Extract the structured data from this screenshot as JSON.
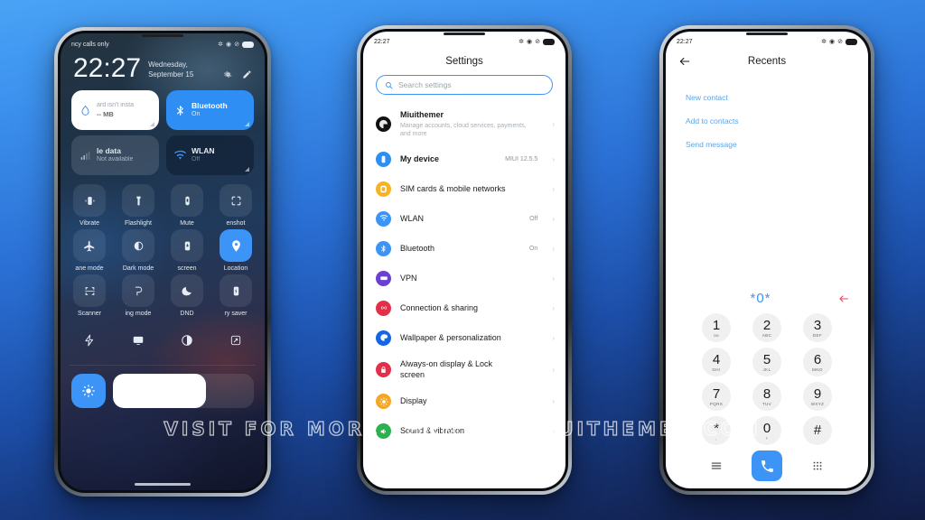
{
  "background": {
    "top_color": "#4aa3f5",
    "bottom_color": "#121c44"
  },
  "watermark": {
    "text": "VISIT FOR MORE THEMES - MIUITHEMER.COM"
  },
  "accent": {
    "blue": "#3c94f6",
    "link_blue": "#5ba5e8",
    "red": "#e8445f"
  },
  "phone1": {
    "name": "control-center",
    "status_bar": {
      "carrier": "ncy calls only",
      "icons": [
        "bluetooth-icon",
        "alarm-icon",
        "dnd-icon"
      ],
      "battery": "battery-icon"
    },
    "clock": {
      "time": "22:27",
      "date_line1": "Wednesday,",
      "date_line2": "September 15"
    },
    "header_actions": [
      "settings-gear-icon",
      "edit-pencil-icon"
    ],
    "big_tiles": [
      {
        "title": "ard isn't insta",
        "sub": "-- MB",
        "icon": "storage-drop-icon",
        "style": "white"
      },
      {
        "title": "Bluetooth",
        "sub": "On",
        "icon": "bluetooth-icon",
        "style": "blue"
      },
      {
        "title": "le data",
        "sub": "Not available",
        "icon": "signal-bars-icon",
        "style": "dim"
      },
      {
        "title": "WLAN",
        "sub": "Off",
        "icon": "wifi-icon",
        "style": "dark"
      }
    ],
    "toggles": [
      {
        "label": "Vibrate",
        "icon": "vibrate-icon",
        "on": false
      },
      {
        "label": "Flashlight",
        "icon": "flashlight-icon",
        "on": false
      },
      {
        "label": "Mute",
        "icon": "mute-icon",
        "on": false
      },
      {
        "label": "enshot",
        "icon": "screenshot-icon",
        "on": false
      },
      {
        "label": "ane mode",
        "icon": "airplane-icon",
        "on": false
      },
      {
        "label": "Dark mode",
        "icon": "dark-mode-icon",
        "on": false
      },
      {
        "label": "screen",
        "icon": "cast-screen-icon",
        "on": false
      },
      {
        "label": "Location",
        "icon": "location-pin-icon",
        "on": true
      },
      {
        "label": "Scanner",
        "icon": "scanner-icon",
        "on": false
      },
      {
        "label": "ing mode",
        "icon": "reading-mode-icon",
        "on": false
      },
      {
        "label": "DND",
        "icon": "dnd-moon-icon",
        "on": false
      },
      {
        "label": "ry saver",
        "icon": "battery-saver-icon",
        "on": false
      }
    ],
    "last_row": [
      {
        "icon": "lightning-icon"
      },
      {
        "icon": "screen-cast-icon"
      },
      {
        "icon": "contrast-icon"
      },
      {
        "icon": "expand-icon"
      }
    ],
    "brightness": {
      "icon": "brightness-icon",
      "level": 66
    }
  },
  "phone2": {
    "name": "settings",
    "status_bar": {
      "time": "22:27",
      "icons": [
        "bluetooth-icon",
        "alarm-icon",
        "dnd-icon"
      ],
      "battery": "battery-icon"
    },
    "title": "Settings",
    "search": {
      "placeholder": "Search settings",
      "icon": "search-icon"
    },
    "rows": [
      {
        "label": "Miuithemer",
        "sub": "Manage accounts, cloud services, payments, and more",
        "value": "",
        "icon": "account-avatar",
        "color": "#111111"
      },
      {
        "label": "My device",
        "sub": "",
        "value": "MIUI 12.5.5",
        "icon": "device-icon",
        "color": "#2f8ef4"
      },
      {
        "label": "SIM cards & mobile networks",
        "sub": "",
        "value": "",
        "icon": "sim-card-icon",
        "color": "#f5b325"
      },
      {
        "label": "WLAN",
        "sub": "",
        "value": "Off",
        "icon": "wifi-icon",
        "color": "#3c94f6"
      },
      {
        "label": "Bluetooth",
        "sub": "",
        "value": "On",
        "icon": "bluetooth-icon",
        "color": "#3c94f6"
      },
      {
        "label": "VPN",
        "sub": "",
        "value": "",
        "icon": "vpn-icon",
        "color": "#6b3fd4"
      },
      {
        "label": "Connection & sharing",
        "sub": "",
        "value": "",
        "icon": "connection-sharing-icon",
        "color": "#e0304a"
      },
      {
        "label": "Wallpaper & personalization",
        "sub": "",
        "value": "",
        "icon": "wallpaper-icon",
        "color": "#1565e8"
      },
      {
        "label": "Always-on display & Lock screen",
        "sub": "",
        "value": "",
        "icon": "lock-icon",
        "color": "#e0304a"
      },
      {
        "label": "Display",
        "sub": "",
        "value": "",
        "icon": "display-brightness-icon",
        "color": "#f5a623"
      },
      {
        "label": "Sound & vibration",
        "sub": "",
        "value": "",
        "icon": "sound-icon",
        "color": "#2bb24c"
      }
    ]
  },
  "phone3": {
    "name": "dialer-recents",
    "status_bar": {
      "time": "22:27",
      "icons": [
        "bluetooth-icon",
        "alarm-icon",
        "dnd-icon"
      ],
      "battery": "battery-icon"
    },
    "back_icon": "back-arrow-icon",
    "title": "Recents",
    "links": [
      "New contact",
      "Add to contacts",
      "Send message"
    ],
    "entry": {
      "number": "*0*",
      "delete_icon": "backspace-arrow-icon"
    },
    "keys": [
      {
        "digit": "1",
        "letters": "oo"
      },
      {
        "digit": "2",
        "letters": "ABC"
      },
      {
        "digit": "3",
        "letters": "DEF"
      },
      {
        "digit": "4",
        "letters": "GHI"
      },
      {
        "digit": "5",
        "letters": "JKL"
      },
      {
        "digit": "6",
        "letters": "MNO"
      },
      {
        "digit": "7",
        "letters": "PQRS"
      },
      {
        "digit": "8",
        "letters": "TUV"
      },
      {
        "digit": "9",
        "letters": "WXYZ"
      },
      {
        "digit": "*",
        "letters": ","
      },
      {
        "digit": "0",
        "letters": "+"
      },
      {
        "digit": "#",
        "letters": ""
      }
    ],
    "bottom": {
      "menu_icon": "menu-lines-icon",
      "call_icon": "phone-call-icon",
      "keypad_icon": "keypad-grid-icon"
    }
  }
}
